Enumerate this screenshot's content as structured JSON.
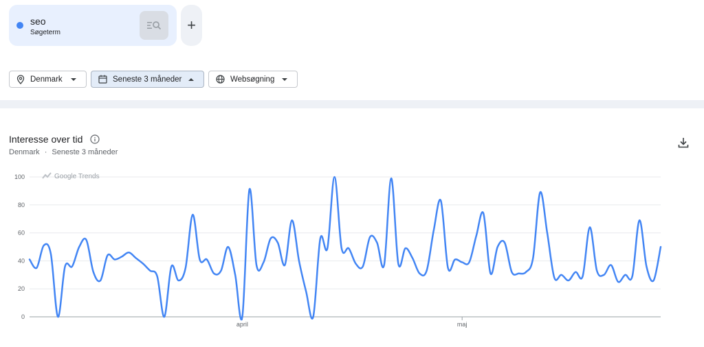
{
  "term": {
    "name": "seo",
    "type": "Søgeterm",
    "color": "#4285f4"
  },
  "add_label": "+",
  "filters": {
    "region": "Denmark",
    "period": "Seneste 3 måneder",
    "source": "Websøgning"
  },
  "section": {
    "title": "Interesse over tid",
    "subtitle_region": "Denmark",
    "subtitle_sep": "·",
    "subtitle_period": "Seneste 3 måneder"
  },
  "chart_data": {
    "type": "line",
    "watermark": "Google Trends",
    "ylim": [
      0,
      100
    ],
    "yticks": [
      0,
      20,
      40,
      60,
      80,
      100
    ],
    "xtick_labels": [
      {
        "label": "april",
        "index": 30
      },
      {
        "label": "maj",
        "index": 61
      }
    ],
    "series": [
      {
        "color": "#4285f4",
        "values": [
          41,
          35,
          51,
          45,
          0,
          36,
          36,
          50,
          55,
          32,
          26,
          44,
          41,
          43,
          46,
          42,
          38,
          33,
          29,
          0,
          36,
          26,
          35,
          73,
          41,
          41,
          31,
          33,
          50,
          30,
          0,
          91,
          37,
          39,
          56,
          53,
          37,
          69,
          40,
          18,
          0,
          56,
          49,
          100,
          49,
          49,
          38,
          36,
          57,
          53,
          37,
          99,
          38,
          49,
          42,
          31,
          33,
          62,
          83,
          35,
          41,
          39,
          39,
          58,
          74,
          31,
          50,
          53,
          32,
          31,
          32,
          42,
          89,
          60,
          28,
          30,
          26,
          32,
          29,
          64,
          33,
          30,
          37,
          25,
          30,
          29,
          69,
          36,
          26,
          50
        ]
      }
    ]
  }
}
